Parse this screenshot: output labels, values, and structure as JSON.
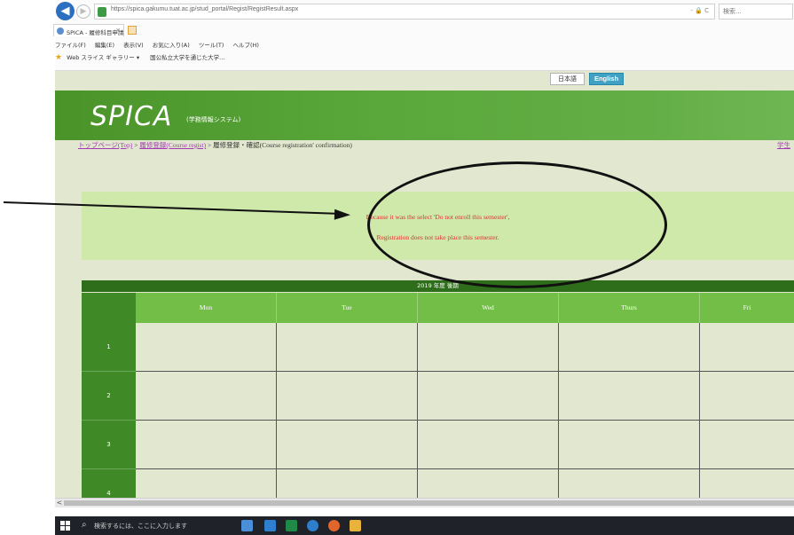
{
  "browser": {
    "url": "https://spica.gakumu.tuat.ac.jp/stud_portal/Regist/RegistResult.aspx",
    "url_actions": "- 🔒 C",
    "search_placeholder": "検索...",
    "tab_title": "SPICA - 履修科目申請 確認",
    "menu": [
      "ファイル(F)",
      "編集(E)",
      "表示(V)",
      "お気に入り(A)",
      "ツール(T)",
      "ヘルプ(H)"
    ],
    "favorites": [
      "Web スライス ギャラリー ▾",
      "国公私立大学を通じた大学..."
    ]
  },
  "lang": {
    "jp": "日本語",
    "en": "English"
  },
  "banner": {
    "logo": "SPICA",
    "subtitle": "(学務情報システム)"
  },
  "breadcrumb": {
    "top": "トップページ(Top)",
    "sep1": " > ",
    "regist": "履修登録(Course regist)",
    "sep2": " > ",
    "current": "履修登録・確認(Course registration' confirmation)",
    "right": "学生"
  },
  "message": {
    "line1": "Because it was the select 'Do not enroll this semester',",
    "line2": "Registration does not take place this semester."
  },
  "timetable": {
    "caption": "2019 年度 後期",
    "days": [
      "Mon",
      "Tue",
      "Wed",
      "Thurs",
      "Fri"
    ],
    "periods": [
      "1",
      "2",
      "3",
      "4"
    ]
  },
  "taskbar": {
    "search_placeholder": "検索するには、ここに入力します"
  },
  "colors": {
    "banner": "#5aa83b",
    "header": "#72be46",
    "period": "#3f8a27",
    "message": "#e23030"
  }
}
